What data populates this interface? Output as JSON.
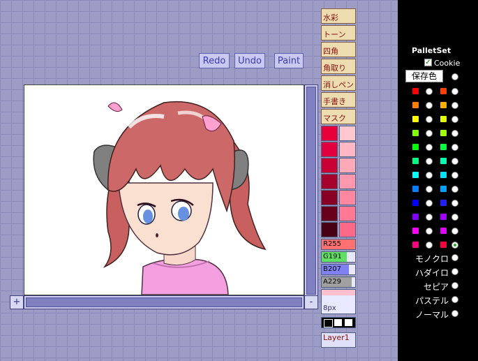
{
  "toolbar": {
    "redo": "Redo",
    "undo": "Undo",
    "paint": "Paint"
  },
  "scroll": {
    "plus": "+",
    "minus": "-"
  },
  "tools": [
    "水彩",
    "トーン",
    "四角",
    "角取り",
    "消しペン",
    "手書き",
    "マスク"
  ],
  "swatches": {
    "left": [
      "#e8003a",
      "#e00040",
      "#c80034",
      "#a8002c",
      "#880024",
      "#68001c",
      "#480014"
    ],
    "right": [
      "#ffc8d0",
      "#ffb8c4",
      "#ffa8b8",
      "#ff98ac",
      "#ff88a0",
      "#ff7894",
      "#ff6888"
    ]
  },
  "rgba": {
    "r": "R255",
    "g": "G191",
    "b": "B207",
    "a": "A229",
    "r_val": 255,
    "g_val": 191,
    "b_val": 207,
    "a_val": 229
  },
  "brush": {
    "size": "8px"
  },
  "layer": {
    "name": "Layer1"
  },
  "palletset": {
    "title": "PalletSet",
    "cookie": "Cookie",
    "save": "保存色"
  },
  "palette_rows": [
    [
      "#ff0000",
      "#ff4000"
    ],
    [
      "#ff8000",
      "#ffb000"
    ],
    [
      "#ffff00",
      "#e0ff00"
    ],
    [
      "#80ff00",
      "#a0ff00"
    ],
    [
      "#00ff00",
      "#00ff40"
    ],
    [
      "#00ff80",
      "#00ffb0"
    ],
    [
      "#00ffff",
      "#00e0ff"
    ],
    [
      "#0080ff",
      "#00a0ff"
    ],
    [
      "#0000ff",
      "#2020ff"
    ],
    [
      "#8000ff",
      "#a000ff"
    ],
    [
      "#ff00ff",
      "#e000ff"
    ],
    [
      "#ff0080",
      "#ff0040"
    ]
  ],
  "presets": [
    "モノクロ",
    "ハダイロ",
    "セピア",
    "パステル",
    "ノーマル"
  ],
  "colors": {
    "accent": "#3a3ab0",
    "tool_text": "#8a1010"
  }
}
